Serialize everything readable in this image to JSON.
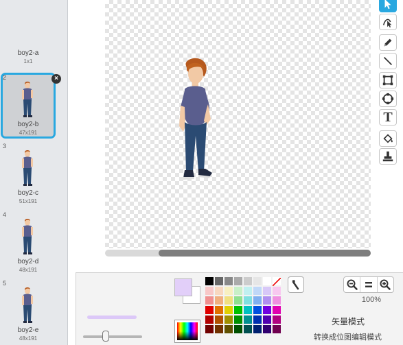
{
  "costumes": [
    {
      "number": "",
      "name": "boy2-a",
      "size": "1x1",
      "selected": false
    },
    {
      "number": "2",
      "name": "boy2-b",
      "size": "47x191",
      "selected": true
    },
    {
      "number": "3",
      "name": "boy2-c",
      "size": "51x191",
      "selected": false
    },
    {
      "number": "4",
      "name": "boy2-d",
      "size": "48x191",
      "selected": false
    },
    {
      "number": "5",
      "name": "boy2-e",
      "size": "48x191",
      "selected": false
    }
  ],
  "costume_close_label": "×",
  "tools": [
    {
      "name": "select-tool",
      "icon": "cursor-icon",
      "active": true
    },
    {
      "name": "reshape-tool",
      "icon": "reshape-icon",
      "active": false
    },
    {
      "name": "pencil-tool",
      "icon": "pencil-icon",
      "active": false
    },
    {
      "name": "line-tool",
      "icon": "line-icon",
      "active": false
    },
    {
      "name": "rectangle-tool",
      "icon": "rectangle-icon",
      "active": false
    },
    {
      "name": "ellipse-tool",
      "icon": "ellipse-icon",
      "active": false
    },
    {
      "name": "text-tool",
      "icon": "text-icon",
      "active": false
    },
    {
      "name": "fill-tool",
      "icon": "bucket-icon",
      "active": false
    },
    {
      "name": "stamp-tool",
      "icon": "stamp-icon",
      "active": false
    }
  ],
  "text_tool_glyph": "T",
  "colors": {
    "primary": "#e2cff9",
    "secondary": "#ffffff",
    "accent": "#29a8e0"
  },
  "palette": [
    [
      "#000000",
      "#666666",
      "#888888",
      "#aaaaaa",
      "#cccccc",
      "#e6e6e6",
      "#ffffff",
      "none"
    ],
    [
      "#f8c8c8",
      "#f8d8c0",
      "#f8f0c0",
      "#c8f0c8",
      "#c0f0f0",
      "#c0d8f8",
      "#d8c8f8",
      "#f8c8f0"
    ],
    [
      "#f09090",
      "#f0b080",
      "#f0e080",
      "#90e090",
      "#80e0e0",
      "#80b0f0",
      "#b090f0",
      "#f090e0"
    ],
    [
      "#e00000",
      "#e07000",
      "#e0d000",
      "#00c000",
      "#00c0c0",
      "#0050e0",
      "#7000e0",
      "#e000b0"
    ],
    [
      "#b00000",
      "#b05000",
      "#a09000",
      "#009000",
      "#009090",
      "#0030b0",
      "#5000b0",
      "#b00080"
    ],
    [
      "#700000",
      "#703000",
      "#605000",
      "#005000",
      "#005050",
      "#002070",
      "#300070",
      "#700050"
    ]
  ],
  "zoom": {
    "out_label": "−",
    "reset_label": "=",
    "in_label": "+",
    "level": "100%"
  },
  "mode_label": "矢量模式",
  "convert_label": "转换成位图编辑模式"
}
